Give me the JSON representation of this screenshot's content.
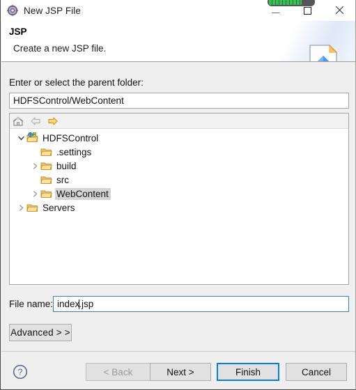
{
  "window": {
    "title": "New JSP File",
    "icon": "wizard-gear-icon",
    "controls": {
      "minimize": "minimize-button",
      "maximize": "maximize-button",
      "close": "close-button"
    },
    "overlay_progress": {
      "name": "progress-pill",
      "color": "#2fc44d",
      "track_color": "#55565a"
    }
  },
  "banner": {
    "title": "JSP",
    "description": "Create a new JSP file.",
    "icon": "jsp-page-wizard-icon"
  },
  "form": {
    "parent_folder_label": "Enter or select the parent folder:",
    "parent_folder_value": "HDFSControl/WebContent",
    "parent_folder_placeholder": "",
    "file_name_label": "File name:",
    "file_name_value_before_caret": "index",
    "file_name_value_after_caret": ".jsp",
    "file_name_value": "index.jsp",
    "file_name_placeholder": "",
    "advanced_label": "Advanced  > >"
  },
  "tree": {
    "toolbar": [
      {
        "name": "home-icon",
        "label": "Home",
        "enabled": true
      },
      {
        "name": "back-arrow-icon",
        "label": "Back",
        "enabled": false
      },
      {
        "name": "forward-arrow-icon",
        "label": "Forward",
        "enabled": true
      }
    ],
    "nodes": [
      {
        "label": "HDFSControl",
        "icon": "web-project-icon",
        "indent": 0,
        "twisty": "expanded",
        "selected": false
      },
      {
        "label": ".settings",
        "icon": "folder-icon",
        "indent": 1,
        "twisty": "none",
        "selected": false
      },
      {
        "label": "build",
        "icon": "folder-icon",
        "indent": 1,
        "twisty": "collapsed",
        "selected": false
      },
      {
        "label": "src",
        "icon": "folder-icon",
        "indent": 1,
        "twisty": "none",
        "selected": false
      },
      {
        "label": "WebContent",
        "icon": "folder-icon",
        "indent": 1,
        "twisty": "collapsed",
        "selected": true
      },
      {
        "label": "Servers",
        "icon": "folder-icon",
        "indent": 0,
        "twisty": "collapsed",
        "selected": false
      }
    ]
  },
  "footer": {
    "help_icon": "help-question-icon",
    "buttons": [
      {
        "name": "back-button",
        "label": "< Back",
        "enabled": false,
        "default": false
      },
      {
        "name": "next-button",
        "label": "Next >",
        "enabled": true,
        "default": false
      },
      {
        "name": "finish-button",
        "label": "Finish",
        "enabled": true,
        "default": true
      },
      {
        "name": "cancel-button",
        "label": "Cancel",
        "enabled": true,
        "default": false
      }
    ]
  },
  "colors": {
    "dialog_background": "#efefef",
    "panel_background": "#ffffff",
    "default_button_border": "#0f7bd4",
    "focus_input_border": "#3a7dc9",
    "selection_background": "#d4d4d4",
    "folder_icon": "#f0b44a",
    "text": "#111111"
  }
}
